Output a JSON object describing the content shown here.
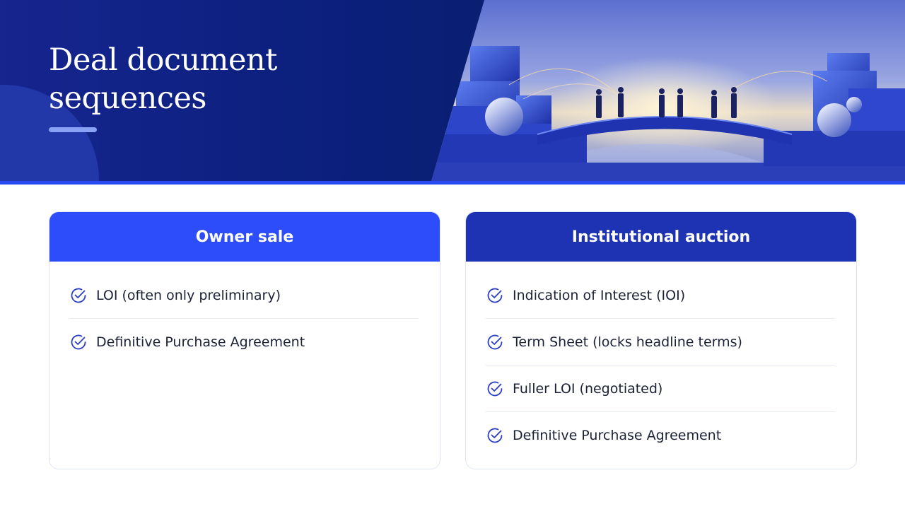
{
  "slide": {
    "title_line1": "Deal document",
    "title_line2": "sequences"
  },
  "header_image": {
    "subject": "people shaking hands on a bridge between two cube cities",
    "accent": "#2a4bf2"
  },
  "cards": {
    "owner_sale": {
      "title": "Owner sale",
      "color": "#2e4dfa",
      "items": [
        "LOI (often only preliminary)",
        "Definitive Purchase Agreement"
      ]
    },
    "institutional_auction": {
      "title": "Institutional auction",
      "color": "#1e32b4",
      "items": [
        "Indication of Interest (IOI)",
        "Term Sheet (locks headline terms)",
        "Fuller LOI (negotiated)",
        "Definitive Purchase Agreement"
      ]
    }
  },
  "icons": {
    "item_icon": "check-circle-icon"
  }
}
